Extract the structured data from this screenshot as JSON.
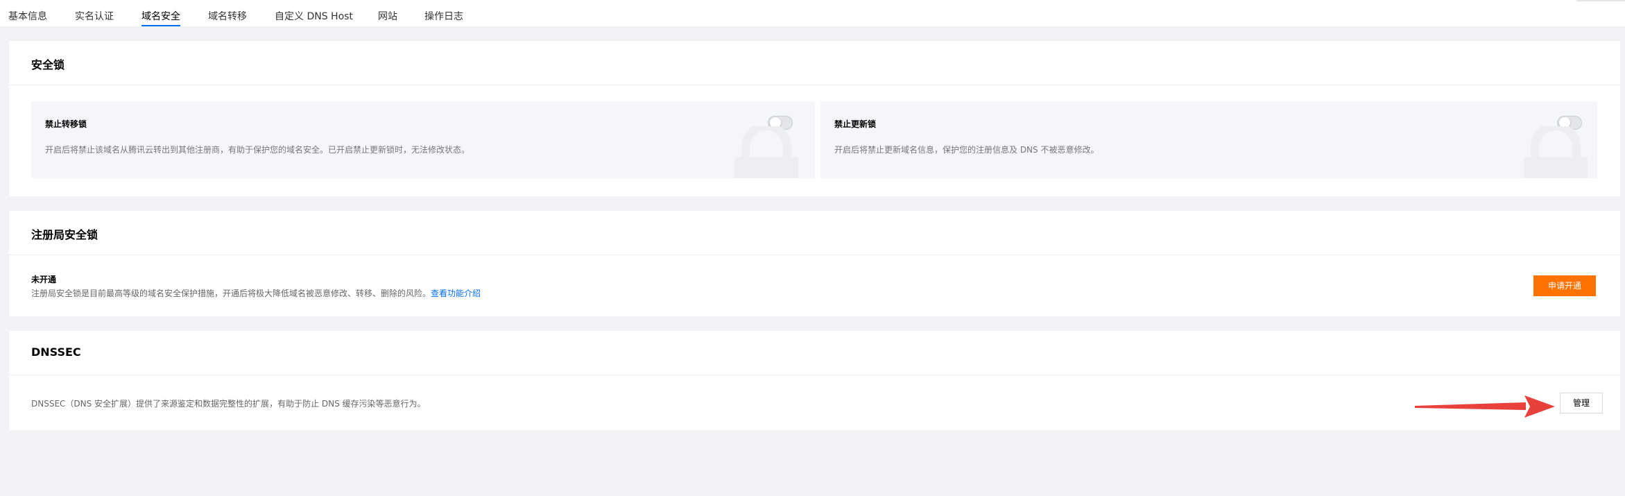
{
  "tabs": [
    {
      "label": "基本信息",
      "active": false
    },
    {
      "label": "实名认证",
      "active": false
    },
    {
      "label": "域名安全",
      "active": true
    },
    {
      "label": "域名转移",
      "active": false
    },
    {
      "label": "自定义 DNS Host",
      "active": false
    },
    {
      "label": "网站",
      "active": false
    },
    {
      "label": "操作日志",
      "active": false
    }
  ],
  "security_lock": {
    "title": "安全锁",
    "transfer_lock": {
      "title": "禁止转移锁",
      "description": "开启后将禁止该域名从腾讯云转出到其他注册商，有助于保护您的域名安全。已开启禁止更新锁时，无法修改状态。",
      "enabled": false
    },
    "update_lock": {
      "title": "禁止更新锁",
      "description": "开启后将禁止更新域名信息，保护您的注册信息及 DNS 不被恶意修改。",
      "enabled": false
    }
  },
  "registry_lock": {
    "title": "注册局安全锁",
    "status": "未开通",
    "description": "注册局安全锁是目前最高等级的域名安全保护措施，开通后将极大降低域名被恶意修改、转移、删除的风险。",
    "link_label": "查看功能介绍",
    "apply_button": "申请开通"
  },
  "dnssec": {
    "title": "DNSSEC",
    "description": "DNSSEC（DNS 安全扩展）提供了来源鉴定和数据完整性的扩展，有助于防止 DNS 缓存污染等恶意行为。",
    "manage_button": "管理"
  },
  "colors": {
    "accent": "#006eff",
    "orange": "#ff7200",
    "arrow": "#e8403a",
    "background": "#f1f2f5"
  }
}
